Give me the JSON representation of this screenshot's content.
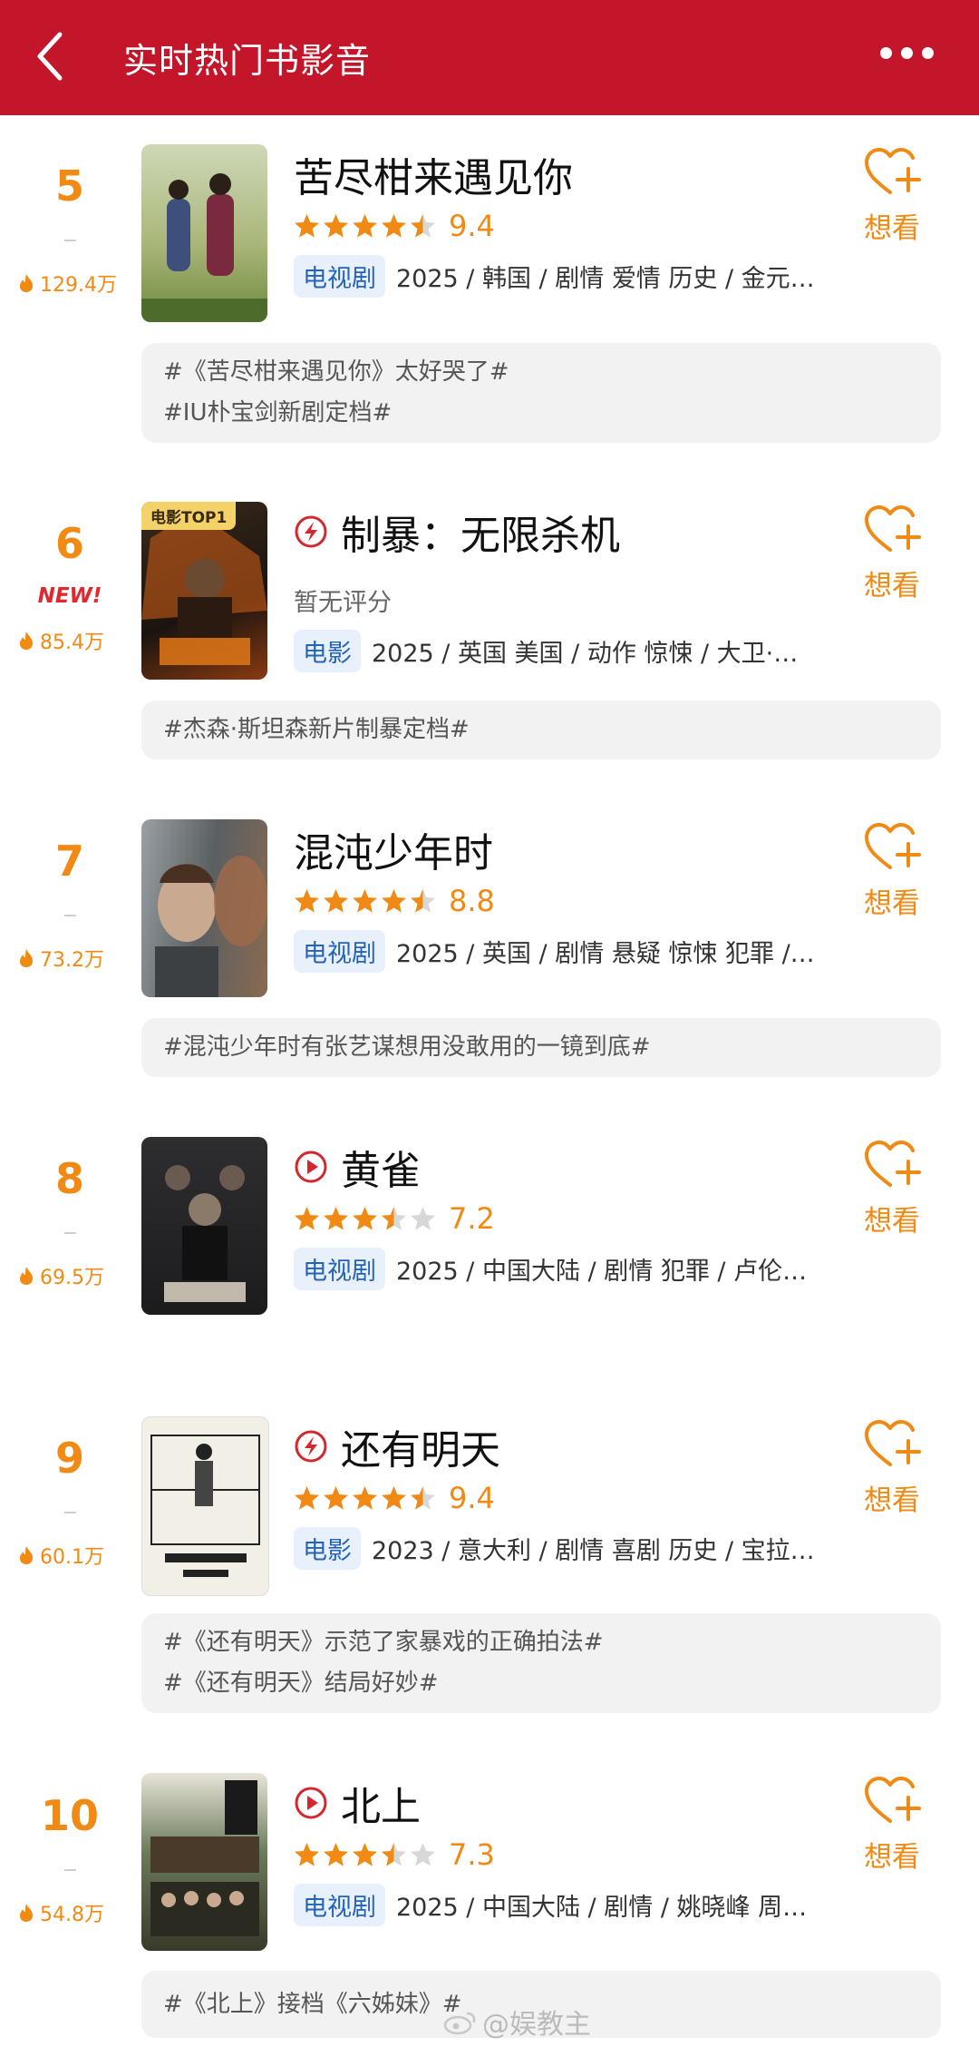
{
  "header": {
    "title": "实时热门书影音",
    "back_icon": "chevron-left-icon",
    "more_icon": "more-dots-icon"
  },
  "items": [
    {
      "rank": "5",
      "heat": "129.4万",
      "title": "苦尽柑来遇见你",
      "score": "9.4",
      "stars": 4.5,
      "tag": "电视剧",
      "meta": "2025 / 韩国 / 剧情 爱情 历史 / 金元…",
      "want": "想看",
      "topics": [
        "#《苦尽柑来遇见你》太好哭了#",
        "#IU朴宝剑新剧定档#"
      ]
    },
    {
      "rank": "6",
      "new_label": "NEW!",
      "heat": "85.4万",
      "title": "制暴：无限杀机",
      "type_icon": "movie-icon",
      "no_rating": "暂无评分",
      "poster_badge": "电影TOP1",
      "tag": "电影",
      "meta": "2025 / 英国 美国 / 动作 惊悚 / 大卫·…",
      "want": "想看",
      "topics": [
        "#杰森·斯坦森新片制暴定档#"
      ]
    },
    {
      "rank": "7",
      "heat": "73.2万",
      "title": "混沌少年时",
      "score": "8.8",
      "stars": 4.5,
      "tag": "电视剧",
      "meta": "2025 / 英国 / 剧情 悬疑 惊悚 犯罪 /…",
      "want": "想看",
      "topics": [
        "#混沌少年时有张艺谋想用没敢用的一镜到底#"
      ]
    },
    {
      "rank": "8",
      "heat": "69.5万",
      "title": "黄雀",
      "type_icon": "play-icon",
      "score": "7.2",
      "stars": 3.5,
      "tag": "电视剧",
      "meta": "2025 / 中国大陆 / 剧情 犯罪 / 卢伦…",
      "want": "想看",
      "topics": []
    },
    {
      "rank": "9",
      "heat": "60.1万",
      "title": "还有明天",
      "type_icon": "movie-icon",
      "score": "9.4",
      "stars": 4.5,
      "tag": "电影",
      "meta": "2023 / 意大利 / 剧情 喜剧 历史 / 宝拉…",
      "want": "想看",
      "topics": [
        "#《还有明天》示范了家暴戏的正确拍法#",
        "#《还有明天》结局好妙#"
      ]
    },
    {
      "rank": "10",
      "heat": "54.8万",
      "title": "北上",
      "type_icon": "play-icon",
      "score": "7.3",
      "stars": 3.5,
      "tag": "电视剧",
      "meta": "2025 / 中国大陆 / 剧情 / 姚晓峰 周…",
      "want": "想看",
      "topics": [
        "#《北上》接档《六姊妹》#"
      ]
    }
  ],
  "watermark": "@娱教主",
  "colors": {
    "header": "#c3162a",
    "accent": "#f08a14",
    "tag_bg": "#e8f0fb",
    "tag_text": "#2563b8"
  }
}
